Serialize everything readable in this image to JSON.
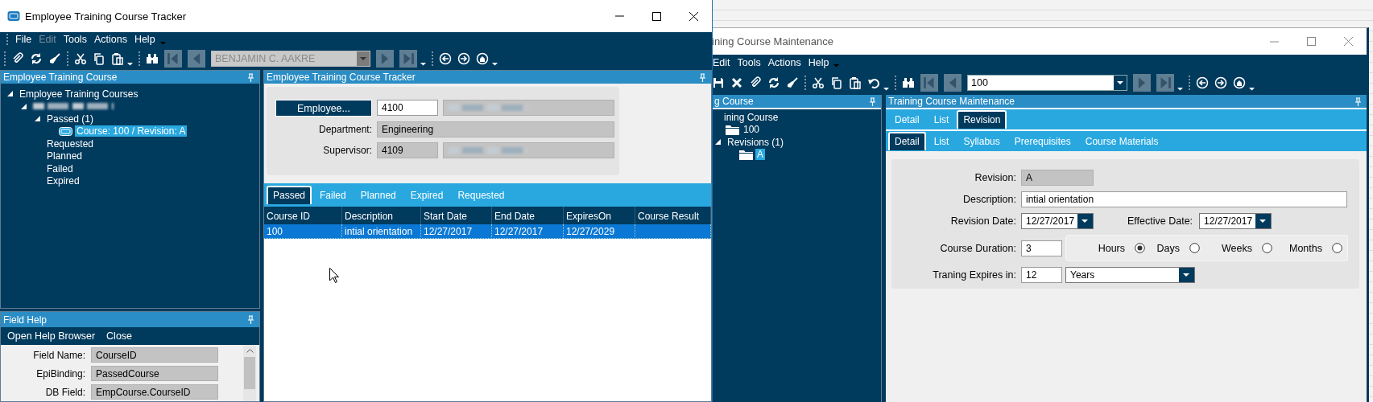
{
  "tracker_window": {
    "title": "Employee Training Course Tracker",
    "menu": [
      {
        "label": "File",
        "disabled": false
      },
      {
        "label": "Edit",
        "disabled": true
      },
      {
        "label": "Tools",
        "disabled": false
      },
      {
        "label": "Actions",
        "disabled": false
      },
      {
        "label": "Help",
        "disabled": false
      }
    ],
    "record_selector": {
      "value": "BENJAMIN C. AAKRE",
      "disabled": true
    },
    "tree_panel": {
      "title": "Employee Training Course",
      "tree": [
        {
          "kind": "node",
          "label": "Employee Training Courses",
          "expanded": true,
          "selected": false,
          "children": [
            {
              "kind": "redacted",
              "expanded": true,
              "selected": false,
              "children": [
                {
                  "kind": "node",
                  "label": "Passed (1)",
                  "expanded": true,
                  "selected": false,
                  "children": [
                    {
                      "kind": "course",
                      "label": "Course: 100 / Revision: A",
                      "selected": true
                    }
                  ]
                },
                {
                  "kind": "node",
                  "label": "Requested",
                  "selected": false
                },
                {
                  "kind": "node",
                  "label": "Planned",
                  "selected": false
                },
                {
                  "kind": "node",
                  "label": "Failed",
                  "selected": false
                },
                {
                  "kind": "node",
                  "label": "Expired",
                  "selected": false
                }
              ]
            }
          ]
        }
      ]
    },
    "field_help": {
      "title": "Field Help",
      "actions": [
        "Open Help Browser",
        "Close"
      ],
      "fields": [
        {
          "label": "Field Name:",
          "value": "CourseID"
        },
        {
          "label": "EpiBinding:",
          "value": "PassedCourse"
        },
        {
          "label": "DB Field:",
          "value": "EmpCourse.CourseID"
        }
      ]
    },
    "main_panel": {
      "title": "Employee Training Course Tracker",
      "rows": [
        {
          "kind": "button",
          "label": "Employee...",
          "value": "4100",
          "readonly": false,
          "redacted": true
        },
        {
          "kind": "label",
          "label": "Department:",
          "value": "Engineering",
          "readonly": true,
          "redacted": false
        },
        {
          "kind": "label",
          "label": "Supervisor:",
          "value": "4109",
          "readonly": true,
          "redacted": true
        }
      ],
      "tabs": [
        {
          "label": "Passed",
          "selected": true
        },
        {
          "label": "Failed",
          "selected": false
        },
        {
          "label": "Planned",
          "selected": false
        },
        {
          "label": "Expired",
          "selected": false
        },
        {
          "label": "Requested",
          "selected": false
        }
      ],
      "table": {
        "columns": [
          "Course ID",
          "Description",
          "Start Date",
          "End Date",
          "ExpiresOn",
          "Course Result"
        ],
        "rows": [
          {
            "selected": true,
            "cells": [
              "100",
              "intial orientation",
              "12/27/2017",
              "12/27/2017",
              "12/27/2029"
            ]
          }
        ]
      }
    }
  },
  "maintenance_window": {
    "title": "ining Course Maintenance",
    "menu": [
      {
        "label": "Edit",
        "disabled": false
      },
      {
        "label": "Tools",
        "disabled": false
      },
      {
        "label": "Actions",
        "disabled": false
      },
      {
        "label": "Help",
        "disabled": false
      }
    ],
    "record_selector": {
      "value": "100",
      "disabled": false
    },
    "tree_panel": {
      "title": "g Course",
      "tree": [
        {
          "kind": "node",
          "label": "ining Course",
          "selected": false,
          "children": [
            {
              "kind": "folder",
              "label": "100",
              "selected": false
            },
            {
              "kind": "node",
              "label": "Revisions (1)",
              "expanded": true,
              "selected": false,
              "children": [
                {
                  "kind": "folder",
                  "label": "A",
                  "selected": true
                }
              ]
            }
          ]
        }
      ]
    },
    "main_panel": {
      "title": "Training Course Maintenance",
      "tabs": [
        {
          "label": "Detail",
          "selected": false
        },
        {
          "label": "List",
          "selected": false
        },
        {
          "label": "Revision",
          "selected": true
        }
      ],
      "subtabs": [
        {
          "label": "Detail",
          "selected": true
        },
        {
          "label": "List",
          "selected": false
        },
        {
          "label": "Syllabus",
          "selected": false
        },
        {
          "label": "Prerequisites",
          "selected": false
        },
        {
          "label": "Course Materials",
          "selected": false
        }
      ],
      "form": {
        "revision": {
          "label": "Revision:",
          "value": "A",
          "readonly": true
        },
        "description": {
          "label": "Description:",
          "value": "intial orientation",
          "readonly": false
        },
        "revision_date": {
          "label": "Revision Date:",
          "value": "12/27/2017"
        },
        "effective_date": {
          "label": "Effective Date:",
          "value": "12/27/2017"
        },
        "course_duration": {
          "label": "Course Duration:",
          "value": "3",
          "readonly": false
        },
        "duration_units": [
          {
            "label": "Hours",
            "selected": true
          },
          {
            "label": "Days",
            "selected": false
          },
          {
            "label": "Weeks",
            "selected": false
          },
          {
            "label": "Months",
            "selected": false
          }
        ],
        "expires_in": {
          "label": "Traning Expires in:",
          "value": "12",
          "readonly": false
        },
        "expires_unit": {
          "value": "Years"
        }
      }
    }
  }
}
